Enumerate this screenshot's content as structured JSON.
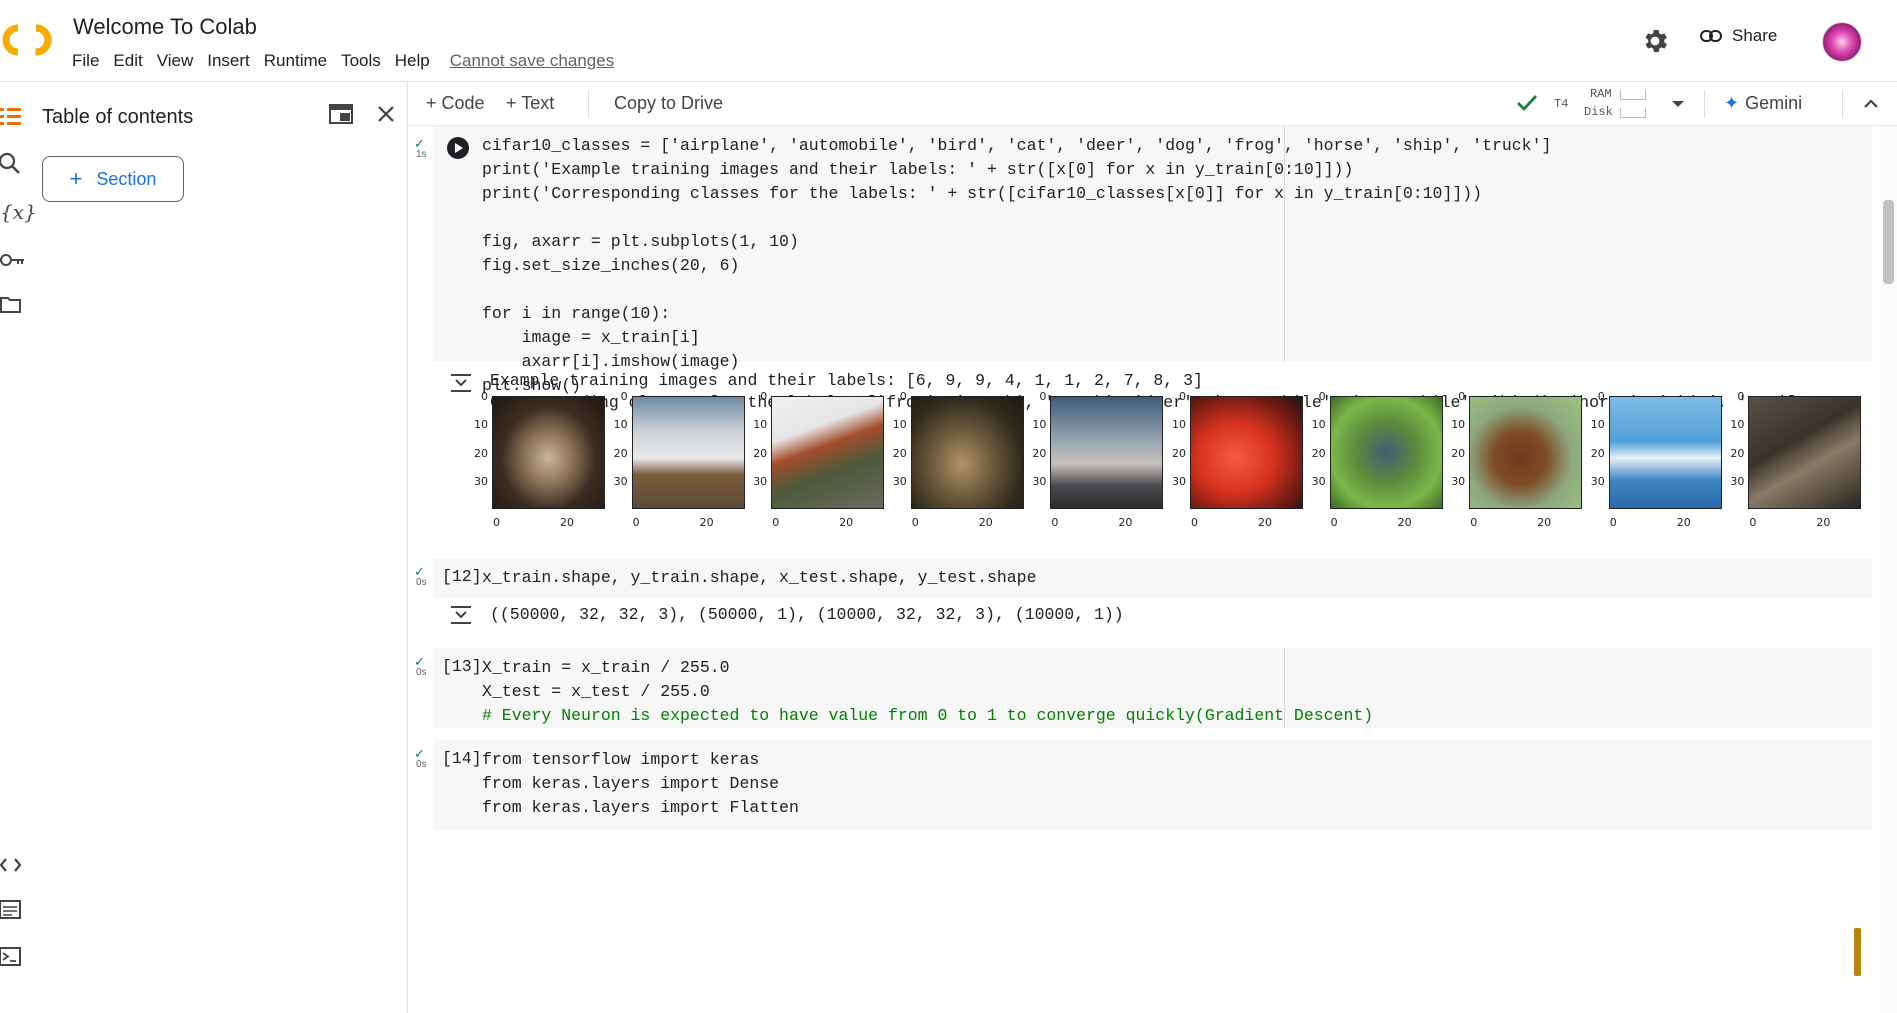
{
  "app": {
    "title": "Welcome To Colab",
    "menu": [
      "File",
      "Edit",
      "View",
      "Insert",
      "Runtime",
      "Tools",
      "Help"
    ],
    "cannot_save": "Cannot save changes",
    "share_label": "Share",
    "brand_color": "#f9ab00",
    "accent_color": "#1a73e8"
  },
  "toolbar": {
    "code_label": "+ Code",
    "text_label": "+ Text",
    "copy_label": "Copy to Drive",
    "gpu": "T4",
    "ram": "RAM",
    "disk": "Disk",
    "gemini": "Gemini"
  },
  "toc": {
    "title": "Table of contents",
    "section_label": "Section"
  },
  "cells": {
    "c1": {
      "time": "1s",
      "lines": [
        "cifar10_classes = ['airplane', 'automobile', 'bird', 'cat', 'deer', 'dog', 'frog', 'horse', 'ship', 'truck']",
        "print('Example training images and their labels: ' + str([x[0] for x in y_train[0:10]]))",
        "print('Corresponding classes for the labels: ' + str([cifar10_classes[x[0]] for x in y_train[0:10]]))",
        "",
        "fig, axarr = plt.subplots(1, 10)",
        "fig.set_size_inches(20, 6)",
        "",
        "for i in range(10):",
        "    image = x_train[i]",
        "    axarr[i].imshow(image)",
        "plt.show()"
      ],
      "output": [
        "Example training images and their labels: [6, 9, 9, 4, 1, 1, 2, 7, 8, 3]",
        "Corresponding classes for the labels: ['frog', 'truck', 'truck', 'deer', 'automobile', 'automobile', 'bird', 'horse', 'ship', 'cat']"
      ],
      "axis": {
        "yticks": [
          "0",
          "10",
          "20",
          "30"
        ],
        "xticks": [
          "0",
          "20"
        ]
      },
      "images": [
        "frog",
        "truck",
        "truck",
        "deer",
        "automobile",
        "automobile",
        "bird",
        "horse",
        "ship",
        "cat"
      ]
    },
    "c12": {
      "count": "[12]",
      "time": "0s",
      "code": "x_train.shape, y_train.shape, x_test.shape, y_test.shape",
      "output": "((50000, 32, 32, 3), (50000, 1), (10000, 32, 32, 3), (10000, 1))"
    },
    "c13": {
      "count": "[13]",
      "time": "0s",
      "lines": [
        "X_train = x_train / 255.0",
        "X_test = x_test / 255.0",
        "# Every Neuron is expected to have value from 0 to 1 to converge quickly(Gradient Descent)"
      ]
    },
    "c14": {
      "count": "[14]",
      "time": "0s",
      "lines": [
        "from tensorflow import keras",
        "from keras.layers import Dense",
        "from keras.layers import Flatten"
      ]
    }
  }
}
